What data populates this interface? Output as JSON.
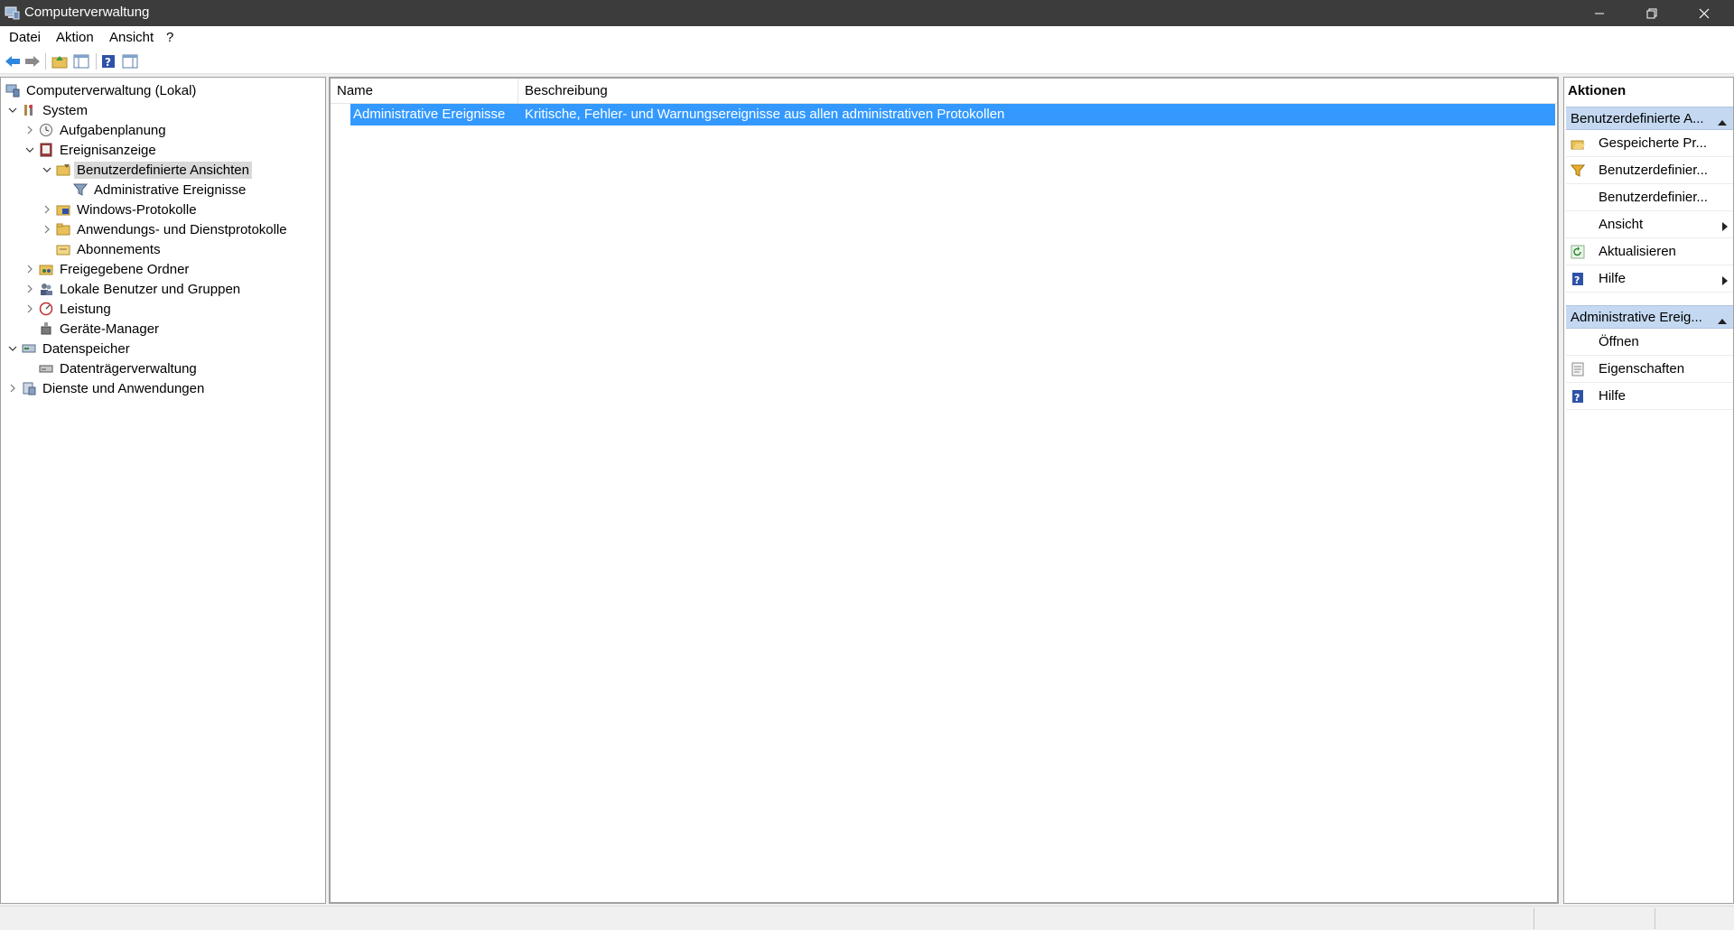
{
  "window": {
    "title": "Computerverwaltung"
  },
  "menu": [
    "Datei",
    "Aktion",
    "Ansicht",
    "?"
  ],
  "toolbar": [
    "back-arrow-icon",
    "forward-arrow-icon",
    "up-folder-icon",
    "show-hide-tree-icon",
    "help-icon",
    "action-pane-icon"
  ],
  "tree": [
    {
      "label": "Computerverwaltung (Lokal)"
    },
    {
      "label": "System"
    },
    {
      "label": "Aufgabenplanung"
    },
    {
      "label": "Ereignisanzeige"
    },
    {
      "label": "Benutzerdefinierte Ansichten"
    },
    {
      "label": "Administrative Ereignisse"
    },
    {
      "label": "Windows-Protokolle"
    },
    {
      "label": "Anwendungs- und Dienstprotokolle"
    },
    {
      "label": "Abonnements"
    },
    {
      "label": "Freigegebene Ordner"
    },
    {
      "label": "Lokale Benutzer und Gruppen"
    },
    {
      "label": "Leistung"
    },
    {
      "label": "Geräte-Manager"
    },
    {
      "label": "Datenspeicher"
    },
    {
      "label": "Datenträgerverwaltung"
    },
    {
      "label": "Dienste und Anwendungen"
    }
  ],
  "list": {
    "columns": [
      "Name",
      "Beschreibung"
    ],
    "rows": [
      {
        "name": "Administrative Ereignisse",
        "description": "Kritische, Fehler- und Warnungsereignisse aus allen administrativen Protokollen"
      }
    ]
  },
  "actions": {
    "title": "Aktionen",
    "sections": [
      {
        "header": "Benutzerdefinierte A...",
        "items": [
          "Gespeicherte Pr...",
          "Benutzerdefinier...",
          "Benutzerdefinier...",
          "Ansicht",
          "Aktualisieren",
          "Hilfe"
        ]
      },
      {
        "header": "Administrative Ereig...",
        "items": [
          "Öffnen",
          "Eigenschaften",
          "Hilfe"
        ]
      }
    ]
  }
}
